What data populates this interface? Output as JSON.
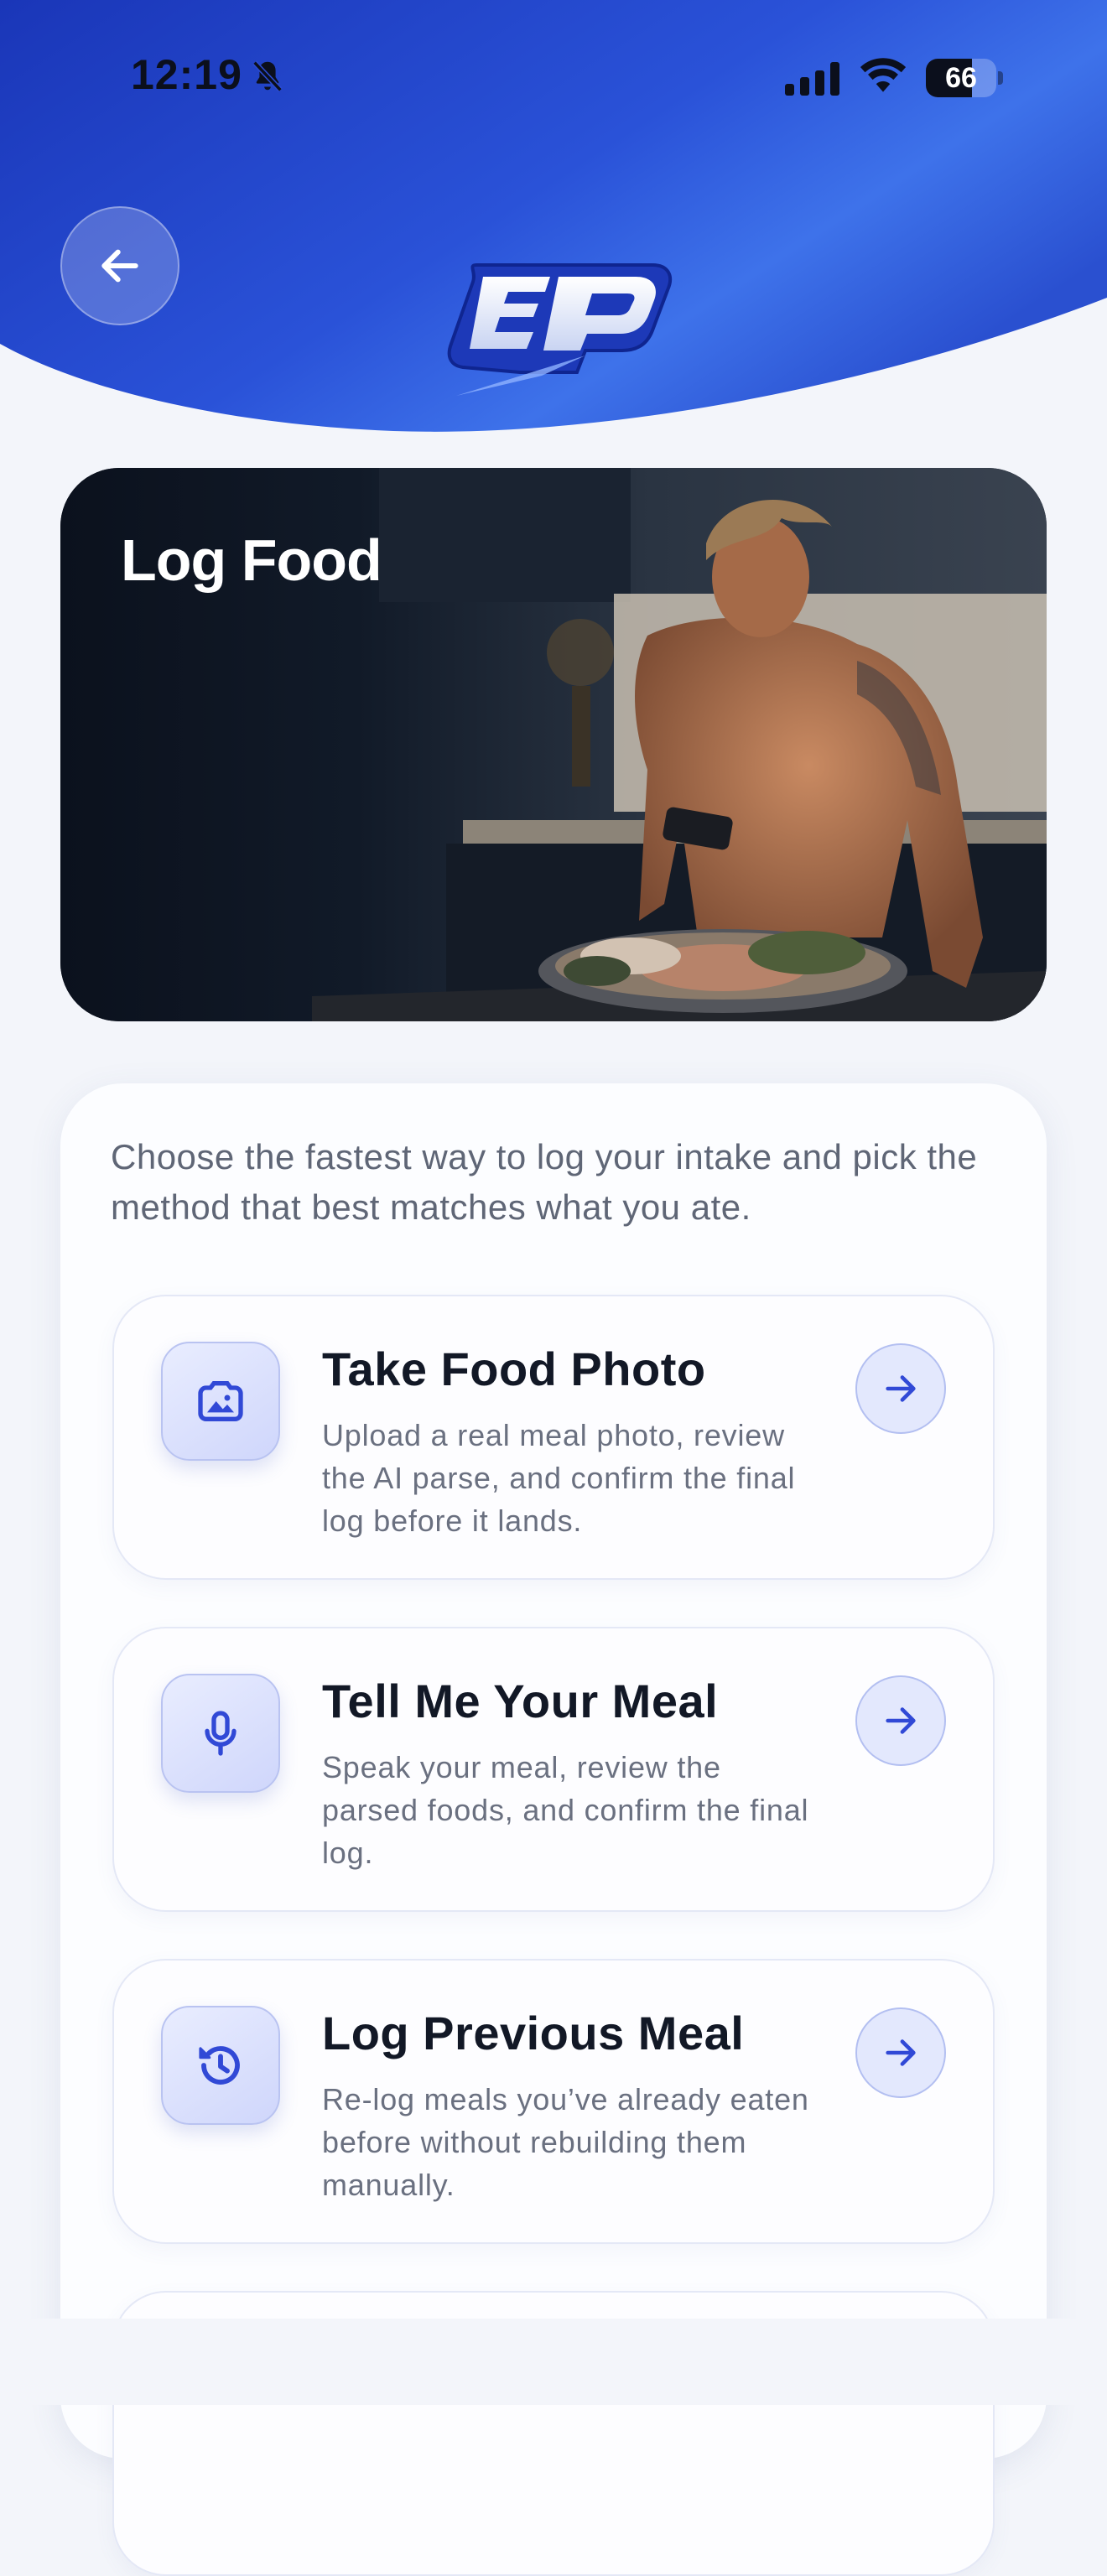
{
  "status_bar": {
    "time": "12:19",
    "battery": "66",
    "battery_level": 0.66,
    "icons": [
      "bell-slash-icon",
      "cellular-signal-icon",
      "wifi-icon",
      "battery-icon"
    ]
  },
  "header": {
    "back_icon": "arrow-left-icon",
    "logo_text": "EP",
    "colors": {
      "gradient_start": "#1d3fc4",
      "gradient_end": "#3c6ee6"
    }
  },
  "hero": {
    "title": "Log Food"
  },
  "card": {
    "intro": "Choose the fastest way to log your intake and pick the method that best matches what you ate.",
    "options": [
      {
        "title": "Take Food Photo",
        "description": "Upload a real meal photo, review the AI parse, and confirm the final log before it lands.",
        "icon": "camera-icon"
      },
      {
        "title": "Tell Me Your Meal",
        "description": "Speak your meal, review the parsed foods, and confirm the final log.",
        "icon": "microphone-icon"
      },
      {
        "title": "Log Previous Meal",
        "description": "Re-log meals you’ve already eaten before without rebuilding them manually.",
        "icon": "history-icon"
      }
    ]
  },
  "accent_color": "#3149d6"
}
